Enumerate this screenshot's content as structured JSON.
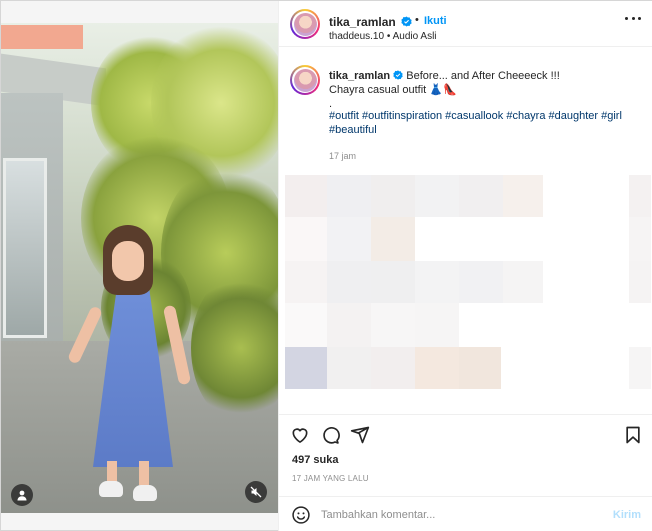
{
  "post": {
    "username": "tika_ramlan",
    "follow_label": "Ikuti",
    "dot": "•",
    "audio_user": "thaddeus.10",
    "audio_sep": "•",
    "audio_label": "Audio Asli",
    "caption_line1": "Before... and After Cheeeeck !!!",
    "caption_line2": "Chayra casual outfit 👗👠",
    "caption_dot": ".",
    "hashtags": "#outfit #outfitinspiration #casuallook #chayra #daughter #girl #beautiful",
    "time_short": "17 jam",
    "likes": "497 suka",
    "time_long": "17 JAM YANG LALU"
  },
  "comment": {
    "placeholder": "Tambahkan komentar...",
    "post_label": "Kirim"
  },
  "icons": {
    "verified": "verified-badge-icon",
    "more": "more-options-icon",
    "like": "heart-icon",
    "comment": "comment-bubble-icon",
    "share": "paper-plane-icon",
    "save": "bookmark-icon",
    "emoji": "emoji-smile-icon",
    "user_tag": "user-tag-icon",
    "mute": "speaker-muted-icon"
  },
  "colors": {
    "accent": "#0095f6",
    "link": "#00376b",
    "muted_text": "#8e8e8e",
    "post_disabled": "#b2dffc"
  }
}
